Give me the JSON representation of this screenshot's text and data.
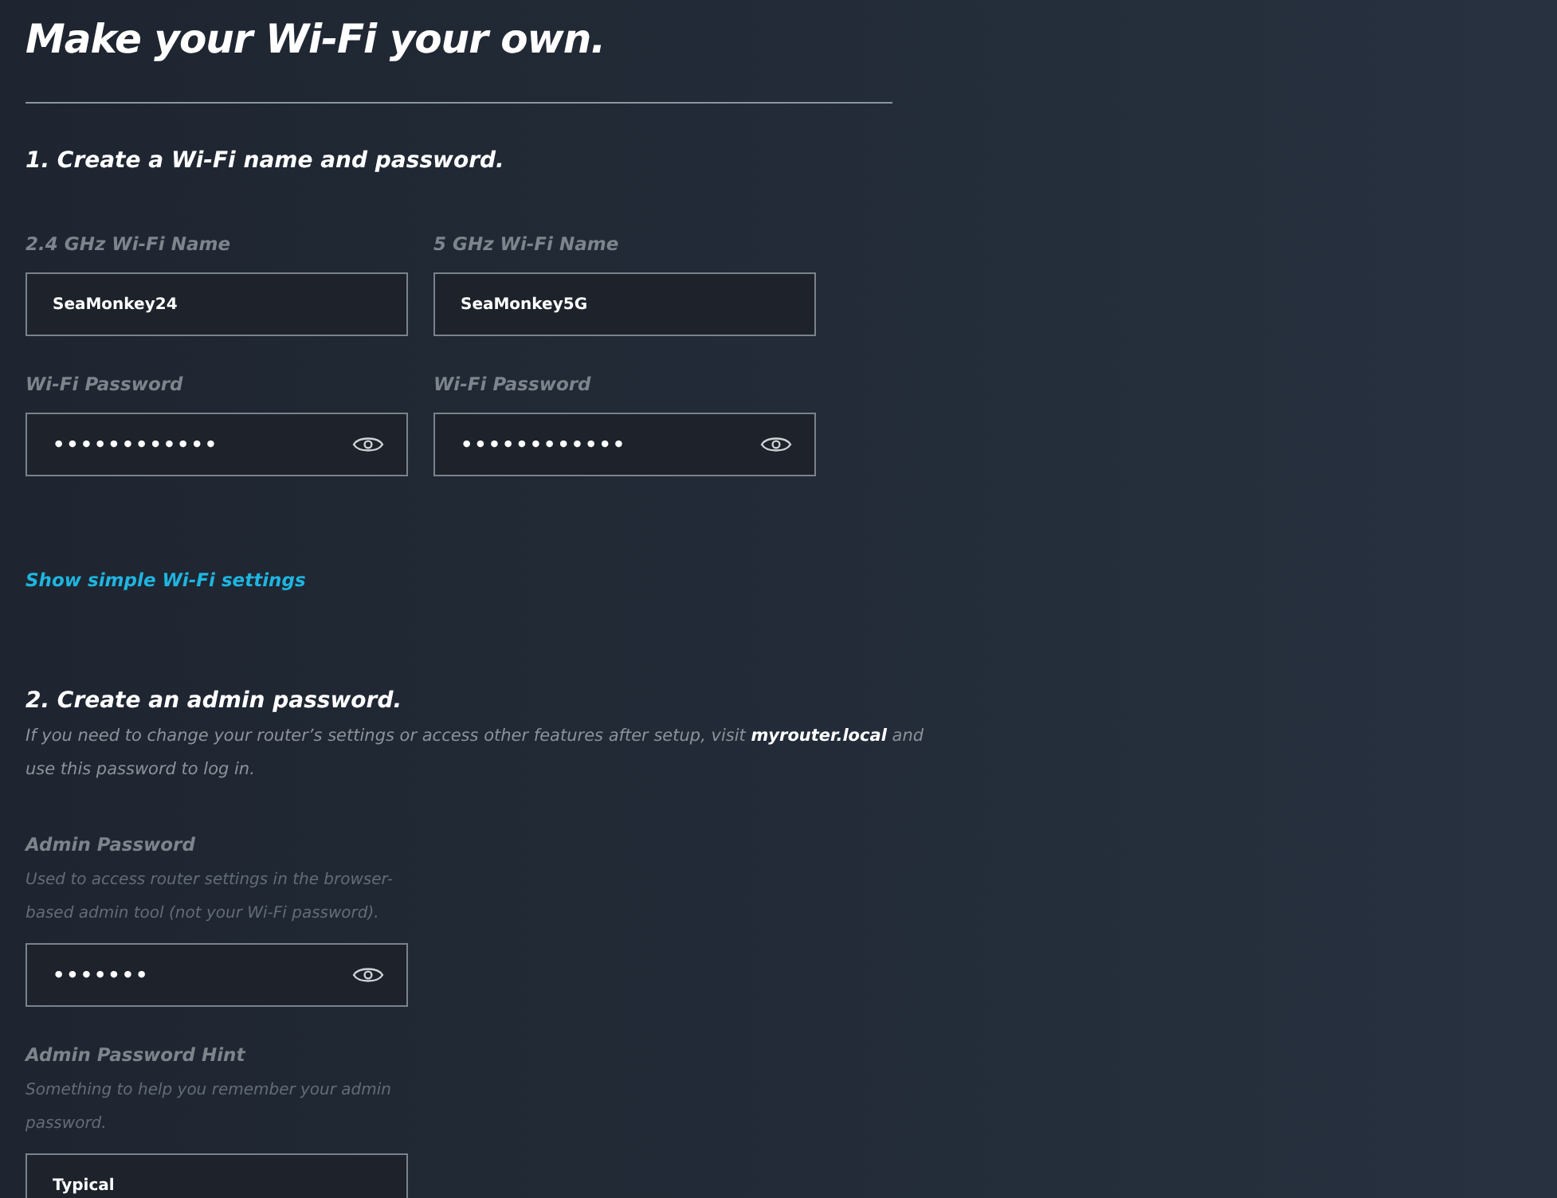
{
  "title": "Make your Wi-Fi your own.",
  "section_1": {
    "heading": "1. Create a Wi-Fi name and password.",
    "fields": [
      {
        "label": "2.4 GHz Wi-Fi Name",
        "value": "SeaMonkey24",
        "kind": "text"
      },
      {
        "label": "5 GHz Wi-Fi Name",
        "value": "SeaMonkey5G",
        "kind": "text"
      },
      {
        "label": "Wi-Fi Password",
        "value": "••••••••••••",
        "kind": "password"
      },
      {
        "label": "Wi-Fi Password",
        "value": "••••••••••••",
        "kind": "password"
      }
    ],
    "link": "Show simple Wi-Fi settings"
  },
  "section_2": {
    "heading": "2. Create an admin password.",
    "description": "If you need to change your router’s settings or access other features after setup, visit **myrouter.local** and use this password to log in.",
    "fields": [
      {
        "label": "Admin Password",
        "hint": "Used to access router settings in the browser-based admin tool (not your Wi-Fi password).",
        "value": "•••••••",
        "kind": "password"
      },
      {
        "label": "Admin Password Hint",
        "hint": "Something to help you remember your admin password.",
        "value": "Typical",
        "kind": "text"
      }
    ]
  }
}
